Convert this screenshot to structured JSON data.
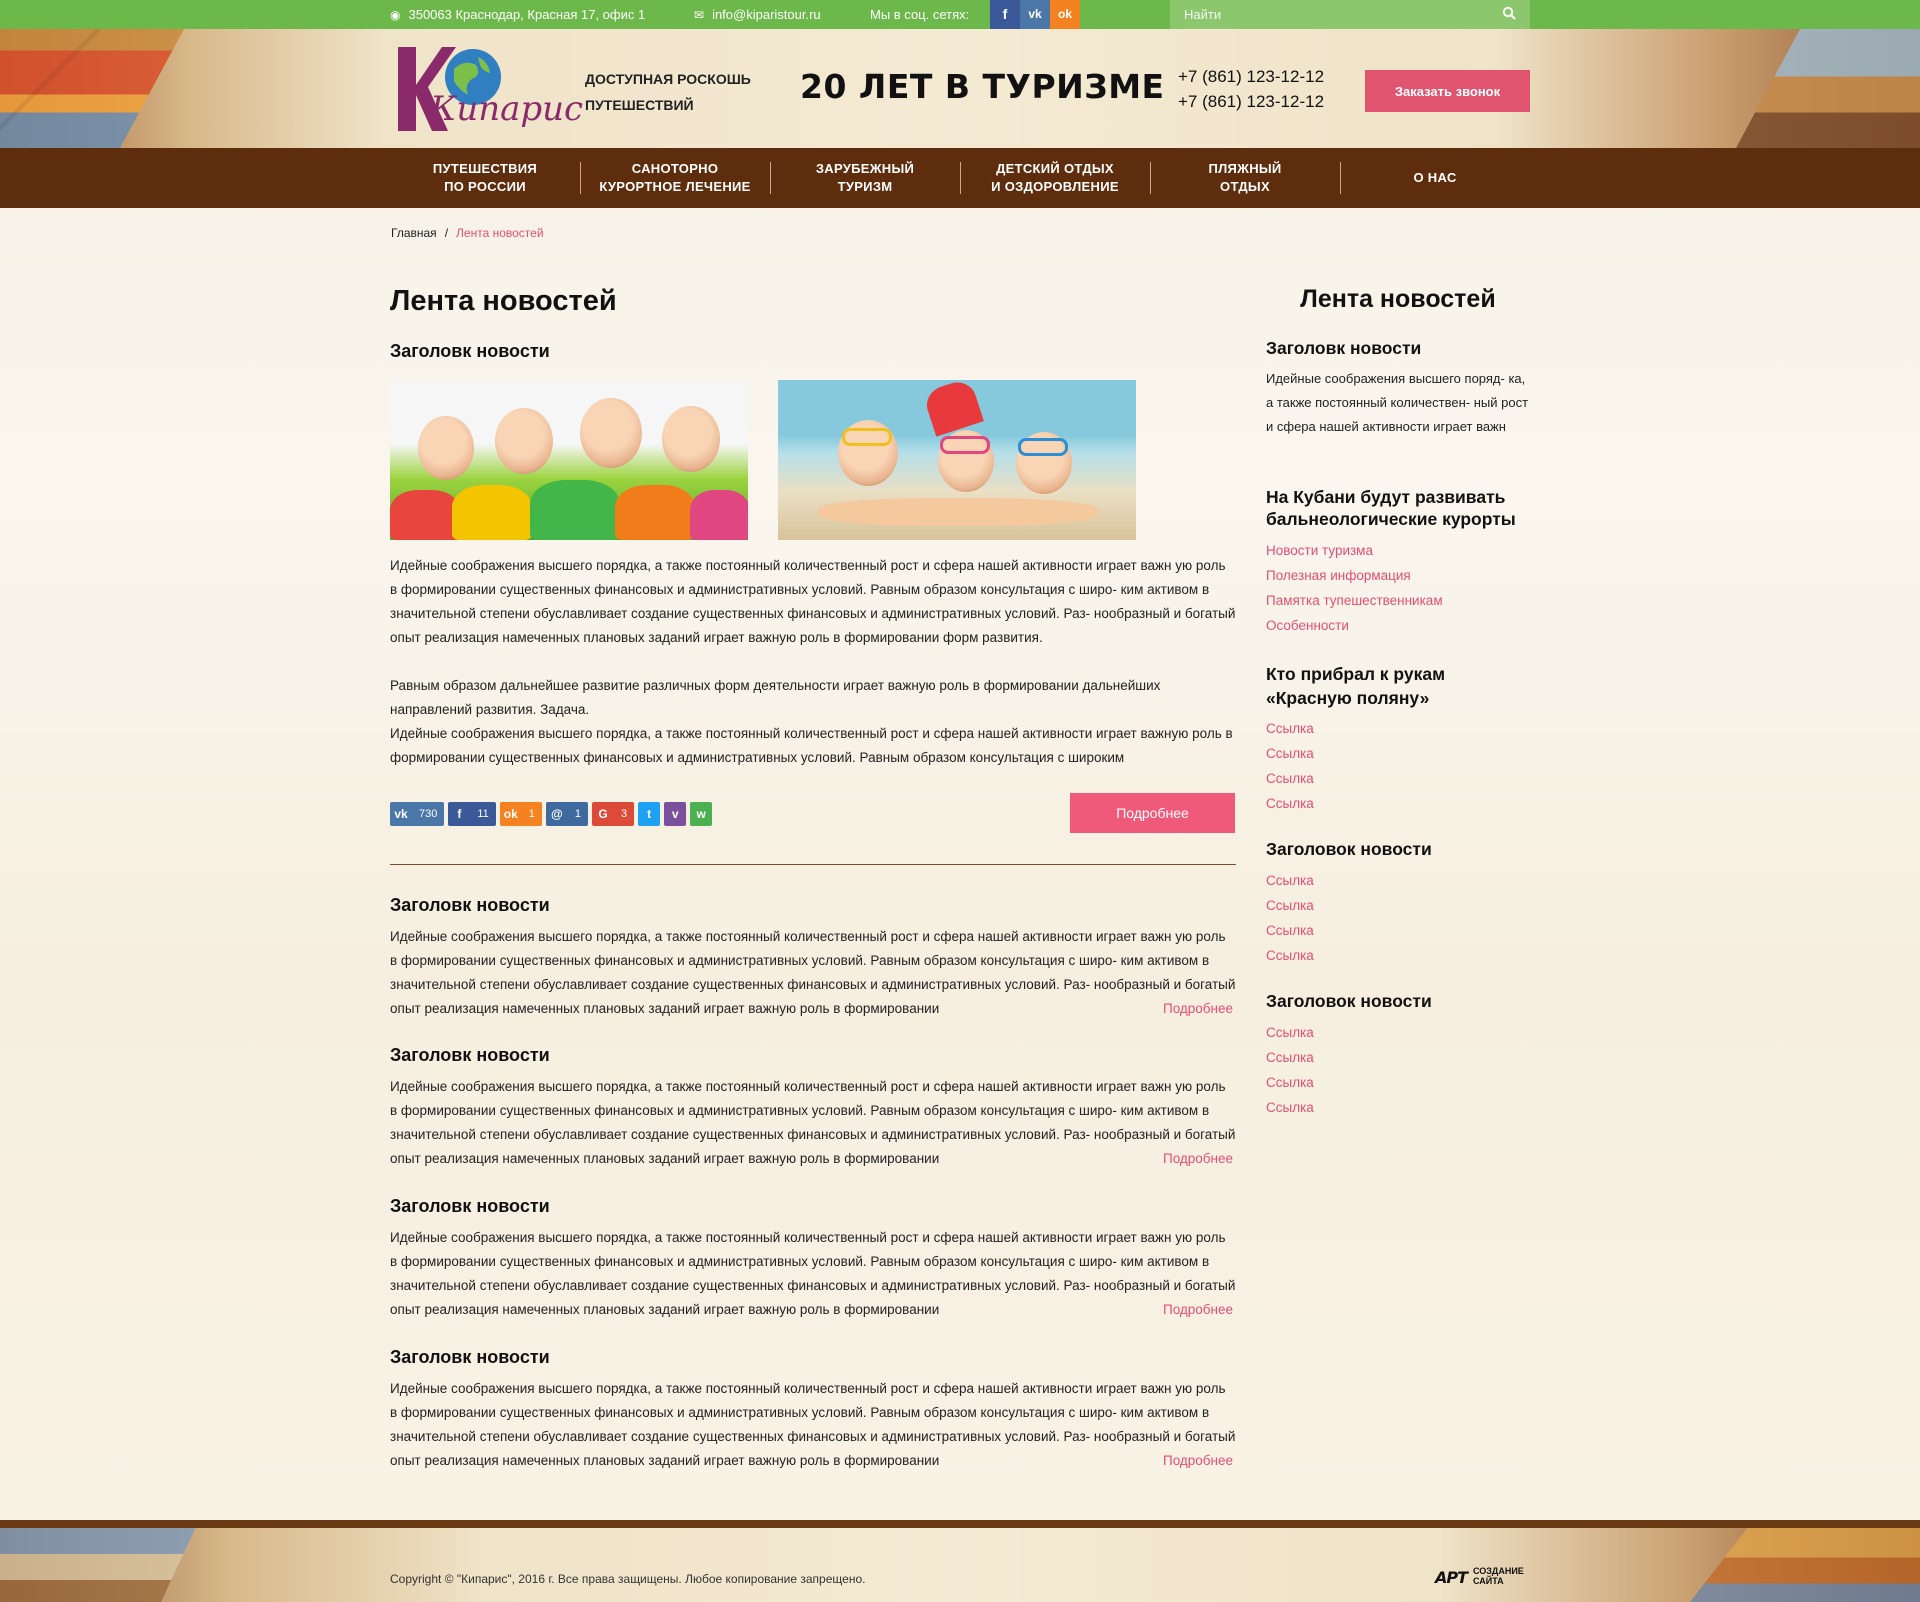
{
  "topbar": {
    "address": "350063 Краснодар, Красная 17, офис 1",
    "email": "info@kiparistour.ru",
    "social_label": "Мы в соц. сетях:",
    "social": [
      {
        "name": "facebook",
        "glyph": "f",
        "color": "#3b5998"
      },
      {
        "name": "vkontakte",
        "glyph": "vk",
        "color": "#4a76a8"
      },
      {
        "name": "odnoklassniki",
        "glyph": "ok",
        "color": "#f58220"
      }
    ],
    "search_placeholder": "Найти"
  },
  "header": {
    "logo_text": "Кипарис",
    "tagline_1": "ДОСТУПНАЯ РОСКОШЬ",
    "tagline_2": "ПУТЕШЕСТВИЙ",
    "slogan": "20 ЛЕТ В ТУРИЗМЕ",
    "phone_1": "+7 (861) 123-12-12",
    "phone_2": "+7 (861) 123-12-12",
    "callback_label": "Заказать звонок"
  },
  "nav": [
    {
      "label": "ПУТЕШЕСТВИЯ\nПО РОССИИ"
    },
    {
      "label": "САНОТОРНО\nКУРОРТНОЕ ЛЕЧЕНИЕ"
    },
    {
      "label": "ЗАРУБЕЖНЫЙ\nТУРИЗМ"
    },
    {
      "label": "ДЕТСКИЙ ОТДЫХ\nИ ОЗДОРОВЛЕНИЕ"
    },
    {
      "label": "ПЛЯЖНЫЙ\nОТДЫХ"
    },
    {
      "label": "О НАС"
    }
  ],
  "breadcrumb": {
    "home": "Главная",
    "separator": "/",
    "current": "Лента новостей"
  },
  "main": {
    "title": "Лента новостей",
    "featured": {
      "title": "Заголовк новости",
      "paragraph_1": "Идейные соображения высшего порядка, а также постоянный количественный рост и сфера нашей активности играет важн ую роль в формировании существенных финансовых и административных условий. Равным образом консультация с широ- ким активом в значительной степени обуславливает создание существенных финансовых и административных условий. Раз- нообразный и богатый опыт реализация намеченных плановых заданий играет важную роль в формировании форм развития.",
      "paragraph_2": "Равным образом дальнейшее развитие различных форм деятельности играет важную роль в формировании дальнейших направлений развития. Задача.",
      "paragraph_3": "Идейные соображения высшего порядка, а также постоянный количественный рост и сфера нашей активности играет важную роль в формировании существенных финансовых и административных условий. Равным образом консультация с широким",
      "more_label": "Подробнее",
      "shares": [
        {
          "name": "vk",
          "glyph": "vk",
          "count": "730",
          "color": "#4a76a8"
        },
        {
          "name": "facebook",
          "glyph": "f",
          "count": "11",
          "color": "#3b5998"
        },
        {
          "name": "odnoklassniki",
          "glyph": "ok",
          "count": "1",
          "color": "#f58220"
        },
        {
          "name": "moimir",
          "glyph": "@",
          "count": "1",
          "color": "#3f6aa0"
        },
        {
          "name": "google-plus",
          "glyph": "G",
          "count": "3",
          "color": "#dc4a38"
        },
        {
          "name": "twitter",
          "glyph": "t",
          "count": "",
          "color": "#1da1f2"
        },
        {
          "name": "viber",
          "glyph": "v",
          "count": "",
          "color": "#7b519d"
        },
        {
          "name": "whatsapp",
          "glyph": "w",
          "count": "",
          "color": "#4caf50"
        }
      ]
    },
    "items": [
      {
        "title": "Заголовк новости",
        "text": "Идейные соображения высшего порядка, а также постоянный количественный рост и сфера нашей активности играет важн ую роль в формировании существенных финансовых и административных условий. Равным образом консультация с широ- ким активом в значительной степени обуславливает создание существенных финансовых и административных условий. Раз- нообразный и богатый опыт реализация намеченных плановых заданий играет важную роль в формировании",
        "more": "Подробнее"
      },
      {
        "title": "Заголовк новости",
        "text": "Идейные соображения высшего порядка, а также постоянный количественный рост и сфера нашей активности играет важн ую роль в формировании существенных финансовых и административных условий. Равным образом консультация с широ- ким активом в значительной степени обуславливает создание существенных финансовых и административных условий. Раз- нообразный и богатый опыт реализация намеченных плановых заданий играет важную роль в формировании",
        "more": "Подробнее"
      },
      {
        "title": "Заголовк новости",
        "text": "Идейные соображения высшего порядка, а также постоянный количественный рост и сфера нашей активности играет важн ую роль в формировании существенных финансовых и административных условий. Равным образом консультация с широ- ким активом в значительной степени обуславливает создание существенных финансовых и административных условий. Раз- нообразный и богатый опыт реализация намеченных плановых заданий играет важную роль в формировании",
        "more": "Подробнее"
      },
      {
        "title": "Заголовк новости",
        "text": "Идейные соображения высшего порядка, а также постоянный количественный рост и сфера нашей активности играет важн ую роль в формировании существенных финансовых и административных условий. Равным образом консультация с широ- ким активом в значительной степени обуславливает создание существенных финансовых и административных условий. Раз- нообразный и богатый опыт реализация намеченных плановых заданий играет важную роль в формировании",
        "more": "Подробнее"
      }
    ]
  },
  "sidebar": {
    "title": "Лента новостей",
    "block_1": {
      "title": "Заголовк новости",
      "text": "Идейные соображения высшего поряд- ка, а также постоянный количествен- ный рост и сфера нашей активности играет важн"
    },
    "block_2": {
      "title": "На Кубани будут развивать бальнеологические курорты",
      "links": [
        "Новости туризма",
        "Полезная информация",
        "Памятка тупешественникам",
        "Особенности"
      ]
    },
    "block_3": {
      "title": "Кто прибрал к рукам «Красную поляну»",
      "links": [
        "Ссылка",
        "Ссылка",
        "Ссылка",
        "Ссылка"
      ]
    },
    "block_4": {
      "title": "Заголовок новости",
      "links": [
        "Ссылка",
        "Ссылка",
        "Ссылка",
        "Ссылка"
      ]
    },
    "block_5": {
      "title": "Заголовок новости",
      "links": [
        "Ссылка",
        "Ссылка",
        "Ссылка",
        "Ссылка"
      ]
    }
  },
  "footer": {
    "copyright": "Copyright © \"Кипарис\", 2016 г.  Все права защищены. Любое копирование запрещено.",
    "dev_logo": "АРТ",
    "dev_text_1": "СОЗДАНИЕ",
    "dev_text_2": "САЙТА"
  },
  "colors": {
    "topbar": "#6db84b",
    "nav": "#5e2d0d",
    "accent": "#e34f74",
    "button": "#f05a7a"
  }
}
